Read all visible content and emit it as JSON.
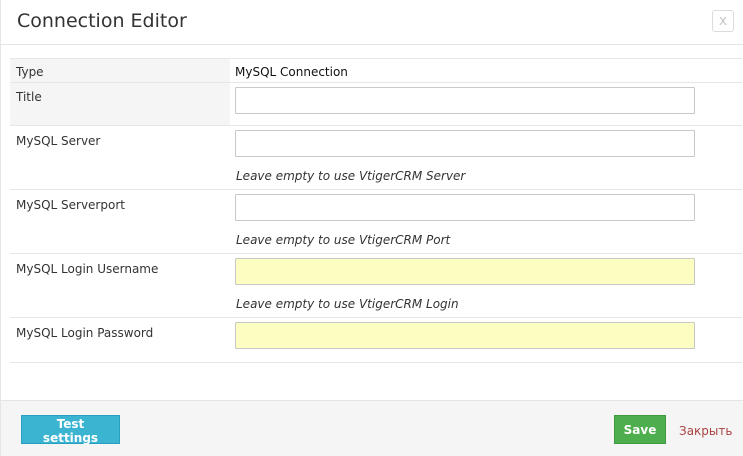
{
  "dialog": {
    "title": "Connection Editor",
    "close_label": "x"
  },
  "form": {
    "type": {
      "label": "Type",
      "value": "MySQL Connection"
    },
    "title_field": {
      "label": "Title",
      "value": ""
    },
    "server": {
      "label": "MySQL Server",
      "value": "",
      "hint": "Leave empty to use VtigerCRM Server"
    },
    "port": {
      "label": "MySQL Serverport",
      "value": "",
      "hint": "Leave empty to use VtigerCRM Port"
    },
    "username": {
      "label": "MySQL Login Username",
      "value": "",
      "hint": "Leave empty to use VtigerCRM Login"
    },
    "password": {
      "label": "MySQL Login Password",
      "value": ""
    }
  },
  "footer": {
    "test_label": "Test settings",
    "save_label": "Save",
    "cancel_label": "Закрыть"
  },
  "colors": {
    "test_button": "#3bb4d2",
    "save_button": "#4cae4c",
    "cancel_link": "#a94442",
    "highlight_input": "#fbfdc1"
  }
}
